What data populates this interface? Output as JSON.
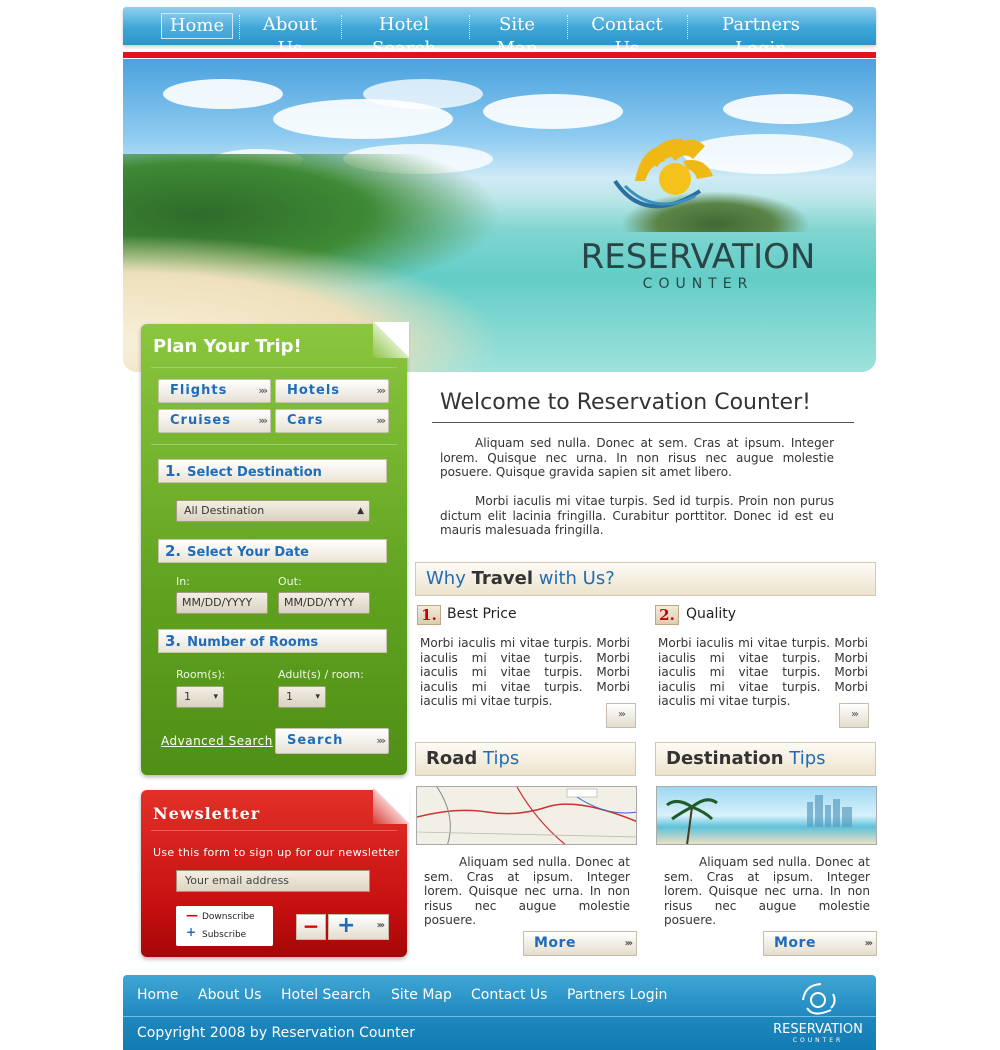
{
  "nav": {
    "items": [
      "Home",
      "About Us",
      "Hotel Search",
      "Site Map",
      "Contact Us",
      "Partners Login"
    ],
    "active": "Home"
  },
  "brand": {
    "name": "RESERVATION",
    "tagline": "COUNTER"
  },
  "plan": {
    "title": "Plan Your Trip!",
    "categories": [
      "Flights",
      "Hotels",
      "Cruises",
      "Cars"
    ],
    "step1": {
      "num": "1.",
      "label": "Select Destination"
    },
    "destination_value": "All Destination",
    "step2": {
      "num": "2.",
      "label": "Select Your Date"
    },
    "in_label": "In:",
    "out_label": "Out:",
    "in_value": "MM/DD/YYYY",
    "out_value": "MM/DD/YYYY",
    "step3": {
      "num": "3.",
      "label": "Number of Rooms"
    },
    "rooms_label": "Room(s):",
    "adults_label": "Adult(s) / room:",
    "rooms_value": "1",
    "adults_value": "1",
    "advanced_link": "Advanced Search",
    "search_button": "Search"
  },
  "newsletter": {
    "title": "Newsletter",
    "description": "Use this form to sign up for our newsletter",
    "email_placeholder": "Your email address",
    "downscribe": "Downscribe",
    "subscribe": "Subscribe",
    "minus": "−",
    "plus": "+"
  },
  "welcome": {
    "title": "Welcome to Reservation Counter!",
    "para1": "Aliquam sed nulla. Donec at sem. Cras at ipsum. Integer lorem. Quisque nec urna. In non risus nec augue molestie posuere. Quisque gravida sapien sit amet libero.",
    "para2": "Morbi iaculis mi vitae turpis. Sed id turpis. Proin non purus dictum elit lacinia fringilla. Curabitur porttitor. Donec id est eu mauris malesuada fringilla."
  },
  "why": {
    "pre": "Why",
    "bold": "Travel",
    "post": "with Us?",
    "features": [
      {
        "num": "1.",
        "title": "Best Price",
        "text": "Morbi iaculis mi vitae turpis. Morbi iaculis mi vitae turpis. Morbi iaculis mi vitae turpis. Morbi iaculis mi vitae turpis. Morbi iaculis mi vitae turpis."
      },
      {
        "num": "2.",
        "title": "Quality",
        "text": "Morbi iaculis mi vitae turpis. Morbi iaculis mi vitae turpis. Morbi iaculis mi vitae turpis. Morbi iaculis mi vitae turpis. Morbi iaculis mi vitae turpis."
      }
    ]
  },
  "tips": [
    {
      "bold": "Road",
      "blue": "Tips",
      "text": "Aliquam sed nulla. Donec at sem. Cras at ipsum. Integer lorem. Quisque nec urna. In non risus nec augue molestie posuere.",
      "more": "More"
    },
    {
      "bold": "Destination",
      "blue": "Tips",
      "text": "Aliquam sed nulla. Donec at sem. Cras at ipsum. Integer lorem. Quisque nec urna. In non risus nec augue molestie posuere.",
      "more": "More"
    }
  ],
  "footer": {
    "links": [
      "Home",
      "About Us",
      "Hotel Search",
      "Site Map",
      "Contact Us",
      "Partners Login"
    ],
    "copyright": "Copyright 2008 by Reservation Counter",
    "logo_name": "RESERVATION",
    "logo_sub": "COUNTER"
  },
  "colors": {
    "nav_blue": "#3ea6d8",
    "accent_red": "#e2131b",
    "plan_green": "#5fa21f",
    "newsletter_red": "#c70f10",
    "link_blue": "#1f6db8"
  }
}
